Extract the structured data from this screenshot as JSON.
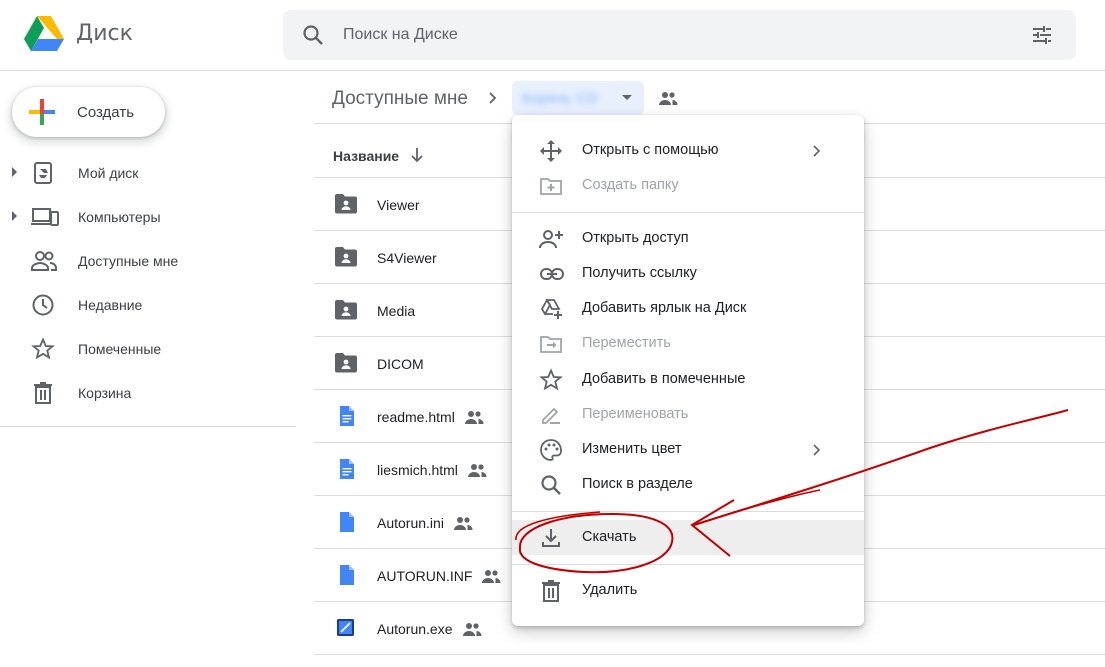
{
  "header": {
    "app_title": "Диск",
    "search_placeholder": "Поиск на Диске"
  },
  "sidebar": {
    "create_label": "Создать",
    "items": [
      {
        "label": "Мой диск",
        "icon": "my-drive-icon",
        "expandable": true
      },
      {
        "label": "Компьютеры",
        "icon": "computers-icon",
        "expandable": true
      },
      {
        "label": "Доступные мне",
        "icon": "shared-with-me-icon",
        "expandable": false
      },
      {
        "label": "Недавние",
        "icon": "clock-icon",
        "expandable": false
      },
      {
        "label": "Помеченные",
        "icon": "star-icon",
        "expandable": false
      },
      {
        "label": "Корзина",
        "icon": "trash-icon",
        "expandable": false
      }
    ]
  },
  "breadcrumb": {
    "root": "Доступные мне",
    "folder": "Корень CD"
  },
  "list": {
    "column_name": "Название",
    "rows": [
      {
        "name": "Viewer",
        "type": "shared-folder",
        "shared": false
      },
      {
        "name": "S4Viewer",
        "type": "shared-folder",
        "shared": false
      },
      {
        "name": "Media",
        "type": "shared-folder",
        "shared": false
      },
      {
        "name": "DICOM",
        "type": "shared-folder",
        "shared": false
      },
      {
        "name": "readme.html",
        "type": "doc",
        "shared": true
      },
      {
        "name": "liesmich.html",
        "type": "doc",
        "shared": true
      },
      {
        "name": "Autorun.ini",
        "type": "file",
        "shared": true
      },
      {
        "name": "AUTORUN.INF",
        "type": "file",
        "shared": true
      },
      {
        "name": "Autorun.exe",
        "type": "exe",
        "shared": true
      }
    ]
  },
  "context_menu": {
    "items": [
      {
        "label": "Открыть с помощью",
        "icon": "open-with-icon",
        "disabled": false,
        "submenu": true
      },
      {
        "label": "Создать папку",
        "icon": "new-folder-icon",
        "disabled": true,
        "submenu": false
      },
      {
        "label": "Открыть доступ",
        "icon": "share-person-icon",
        "disabled": false,
        "submenu": false
      },
      {
        "label": "Получить ссылку",
        "icon": "link-icon",
        "disabled": false,
        "submenu": false
      },
      {
        "label": "Добавить ярлык на Диск",
        "icon": "add-shortcut-icon",
        "disabled": false,
        "submenu": false
      },
      {
        "label": "Переместить",
        "icon": "move-icon",
        "disabled": true,
        "submenu": false
      },
      {
        "label": "Добавить в помеченные",
        "icon": "star-icon",
        "disabled": false,
        "submenu": false
      },
      {
        "label": "Переименовать",
        "icon": "rename-icon",
        "disabled": true,
        "submenu": false
      },
      {
        "label": "Изменить цвет",
        "icon": "palette-icon",
        "disabled": false,
        "submenu": true
      },
      {
        "label": "Поиск в разделе",
        "icon": "search-icon",
        "disabled": false,
        "submenu": false
      },
      {
        "label": "Скачать",
        "icon": "download-icon",
        "disabled": false,
        "submenu": false,
        "highlighted": true
      },
      {
        "label": "Удалить",
        "icon": "trash-icon",
        "disabled": false,
        "submenu": false
      }
    ]
  },
  "colors": {
    "accent_blue": "#4285f4",
    "annotation_red": "#c00000",
    "icon_gray": "#5f6368",
    "disabled_gray": "#a0a4a8"
  }
}
